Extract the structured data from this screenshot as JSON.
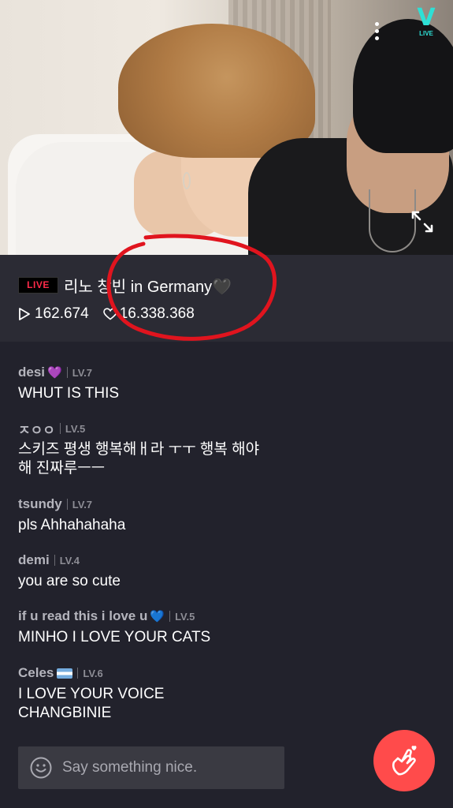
{
  "video": {
    "logo_text": "V",
    "logo_sub": "LIVE",
    "menu_icon": "more-vertical-icon",
    "expand_icon": "expand-icon"
  },
  "info": {
    "live_badge": "LIVE",
    "title": "리노 창빈 in Germany🖤",
    "plays": "162.674",
    "hearts": "16.338.368"
  },
  "comments": [
    {
      "user": "desi",
      "emoji": "💜",
      "level": "LV.7",
      "text": "WHUT IS THIS"
    },
    {
      "user": "ㅈㅇㅇ",
      "emoji": "",
      "level": "LV.5",
      "text": "스키즈 평생 행복해ㅐ라 ㅜㅜ 행복 해야 해 진짜루ㅡㅡ"
    },
    {
      "user": "tsundy",
      "emoji": "",
      "level": "LV.7",
      "text": "pls Ahhahahaha"
    },
    {
      "user": "demi",
      "emoji": "",
      "level": "LV.4",
      "text": "you are so cute"
    },
    {
      "user": "if u read this i love u",
      "emoji": "💙",
      "level": "LV.5",
      "text": "MINHO I LOVE YOUR CATS"
    },
    {
      "user": "Celes",
      "emoji": "",
      "level": "LV.6",
      "text": "I LOVE YOUR VOICE CHANGBINIE"
    }
  ],
  "input": {
    "placeholder": "Say something nice."
  },
  "colors": {
    "background": "#22222c",
    "info_bar": "#2b2b34",
    "live_red": "#ff2b4a",
    "heart_button": "#ff4b4b",
    "annotation_red": "#e0141e",
    "vlive_cyan": "#2ee0d6"
  }
}
